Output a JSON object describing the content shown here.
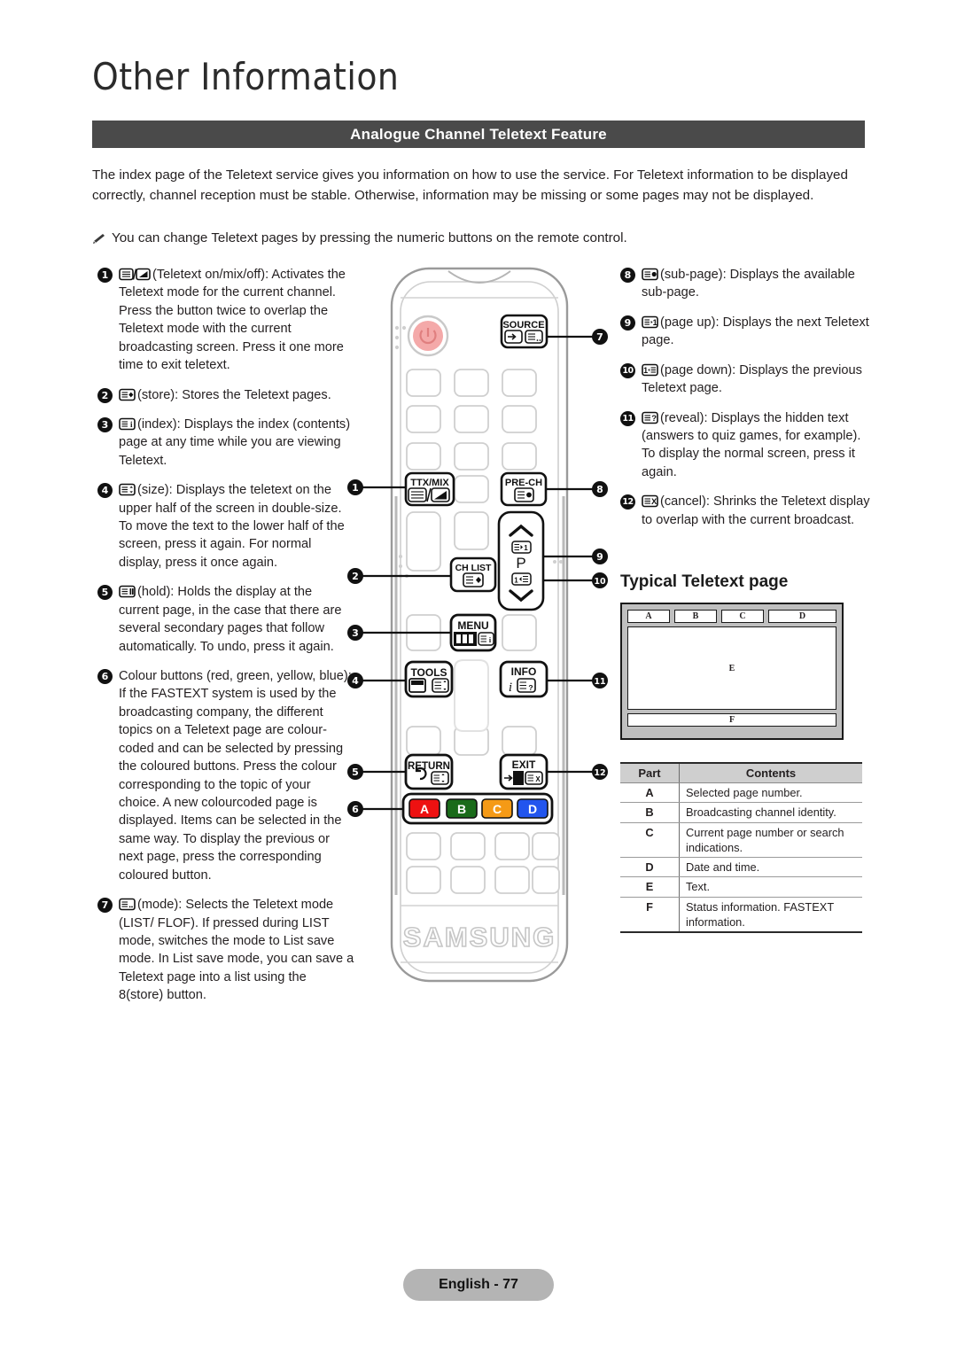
{
  "header": {
    "page_title": "Other Information",
    "section_title": "Analogue Channel Teletext Feature"
  },
  "intro": {
    "paragraph": "The index page of the Teletext service gives you information on how to use the service. For Teletext information to be displayed correctly, channel reception must be stable. Otherwise, information may be missing or some pages may not be displayed.",
    "note": "You can change Teletext pages by pressing the numeric buttons on the remote control."
  },
  "left_column": [
    {
      "num": "1",
      "icon": "teletext-on-mix-off-icon",
      "text": "(Teletext on/mix/off): Activates the Teletext mode for the current channel. Press the button twice to overlap the Teletext mode with the current broadcasting screen. Press it one more time to exit teletext."
    },
    {
      "num": "2",
      "icon": "teletext-store-icon",
      "text": "(store): Stores the Teletext pages."
    },
    {
      "num": "3",
      "icon": "teletext-index-icon",
      "text": "(index): Displays the index (contents) page at any time while you are viewing Teletext."
    },
    {
      "num": "4",
      "icon": "teletext-size-icon",
      "text": "(size): Displays the teletext on the upper half of the screen in double-size. To move the text to the lower half of the screen, press it again. For normal display, press it once again."
    },
    {
      "num": "5",
      "icon": "teletext-hold-icon",
      "text": "(hold): Holds the display at the current page, in the case that there are several secondary pages that follow automatically. To undo, press it again."
    },
    {
      "num": "6",
      "icon": "",
      "text": "Colour buttons (red, green, yellow, blue): If the FASTEXT system is used by the broadcasting company, the different topics on a Teletext page are colour-coded and can be selected by pressing the coloured buttons. Press the colour corresponding to the topic of your choice. A new colourcoded page is displayed. Items can be selected in the same way. To display the previous or next page, press the corresponding coloured button."
    },
    {
      "num": "7",
      "icon": "teletext-mode-icon",
      "text": "(mode): Selects the Teletext mode (LIST/ FLOF). If pressed during LIST mode, switches the mode to List save mode. In List save mode, you can save a Teletext page into a list using the 8(store) button."
    }
  ],
  "right_column": [
    {
      "num": "8",
      "icon": "teletext-sub-page-icon",
      "text": "(sub-page): Displays the available sub-page."
    },
    {
      "num": "9",
      "icon": "teletext-page-up-icon",
      "text": "(page up): Displays the next Teletext page."
    },
    {
      "num": "10",
      "icon": "teletext-page-down-icon",
      "text": "(page down): Displays the previous Teletext page."
    },
    {
      "num": "11",
      "icon": "teletext-reveal-icon",
      "text": "(reveal): Displays the hidden text (answers to quiz games, for example). To display the normal screen, press it again."
    },
    {
      "num": "12",
      "icon": "teletext-cancel-icon",
      "text": "(cancel): Shrinks the Teletext display to overlap with the current broadcast."
    }
  ],
  "typical_page": {
    "heading": "Typical Teletext page",
    "diagram_labels": {
      "a": "A",
      "b": "B",
      "c": "C",
      "d": "D",
      "e": "E",
      "f": "F"
    },
    "table": {
      "headers": [
        "Part",
        "Contents"
      ],
      "rows": [
        [
          "A",
          "Selected page number."
        ],
        [
          "B",
          "Broadcasting channel identity."
        ],
        [
          "C",
          "Current page number or search indications."
        ],
        [
          "D",
          "Date and time."
        ],
        [
          "E",
          "Text."
        ],
        [
          "F",
          "Status information. FASTEXT information."
        ]
      ]
    }
  },
  "remote": {
    "brand": "SAMSUNG",
    "buttons": {
      "source": "SOURCE",
      "ttx_mix": "TTX/MIX",
      "pre_ch": "PRE-CH",
      "ch_list": "CH LIST",
      "p_label": "P",
      "menu": "MENU",
      "tools": "TOOLS",
      "info": "INFO",
      "return": "RETURN",
      "exit": "EXIT"
    },
    "colour_buttons": [
      {
        "label": "A",
        "color": "#ee1111"
      },
      {
        "label": "B",
        "color": "#1a6b1a"
      },
      {
        "label": "C",
        "color": "#f59a16"
      },
      {
        "label": "D",
        "color": "#2255ee"
      }
    ],
    "callouts": [
      "1",
      "2",
      "3",
      "4",
      "5",
      "6",
      "7",
      "8",
      "9",
      "10",
      "11",
      "12"
    ]
  },
  "footer": {
    "label": "English - 77"
  },
  "colors": {
    "section_bar": "#4a4a4a",
    "footer_pill": "#b4b4b4",
    "power_button": "#f4a9a9",
    "diagram_frame": "#bfbfbf"
  }
}
